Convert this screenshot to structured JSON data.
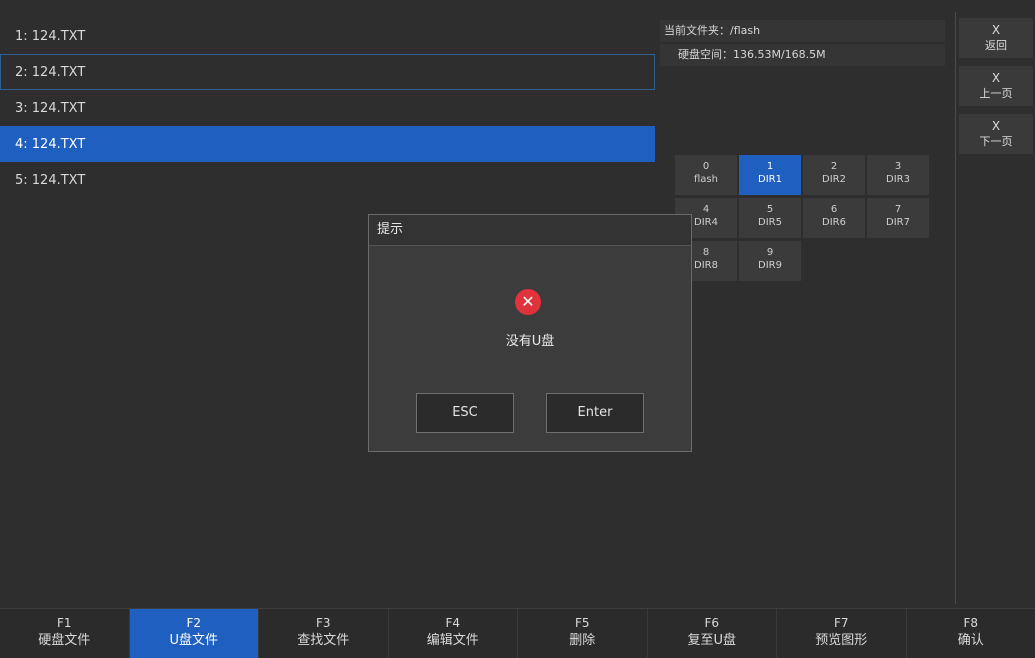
{
  "files": [
    {
      "label": "1: 124.TXT"
    },
    {
      "label": "2: 124.TXT"
    },
    {
      "label": "3: 124.TXT"
    },
    {
      "label": "4: 124.TXT"
    },
    {
      "label": "5: 124.TXT"
    }
  ],
  "info": {
    "current_folder": "当前文件夹：/flash",
    "disk_space": "硬盘空间：136.53M/168.5M"
  },
  "dirs": [
    {
      "num": "0",
      "name": "flash"
    },
    {
      "num": "1",
      "name": "DIR1"
    },
    {
      "num": "2",
      "name": "DIR2"
    },
    {
      "num": "3",
      "name": "DIR3"
    },
    {
      "num": "4",
      "name": "DIR4"
    },
    {
      "num": "5",
      "name": "DIR5"
    },
    {
      "num": "6",
      "name": "DIR6"
    },
    {
      "num": "7",
      "name": "DIR7"
    },
    {
      "num": "8",
      "name": "DIR8"
    },
    {
      "num": "9",
      "name": "DIR9"
    }
  ],
  "side": [
    {
      "key": "X",
      "label": "返回"
    },
    {
      "key": "X",
      "label": "上一页"
    },
    {
      "key": "X",
      "label": "下一页"
    }
  ],
  "fkeys": [
    {
      "num": "F1",
      "label": "硬盘文件"
    },
    {
      "num": "F2",
      "label": "U盘文件"
    },
    {
      "num": "F3",
      "label": "查找文件"
    },
    {
      "num": "F4",
      "label": "编辑文件"
    },
    {
      "num": "F5",
      "label": "删除"
    },
    {
      "num": "F6",
      "label": "复至U盘"
    },
    {
      "num": "F7",
      "label": "预览图形"
    },
    {
      "num": "F8",
      "label": "确认"
    }
  ],
  "dialog": {
    "title": "提示",
    "message": "没有U盘",
    "esc_label": "ESC",
    "enter_label": "Enter",
    "icon": "error-icon"
  },
  "colors": {
    "accent": "#1f5fbf",
    "error": "#e0323a",
    "background": "#2e2e2e"
  }
}
